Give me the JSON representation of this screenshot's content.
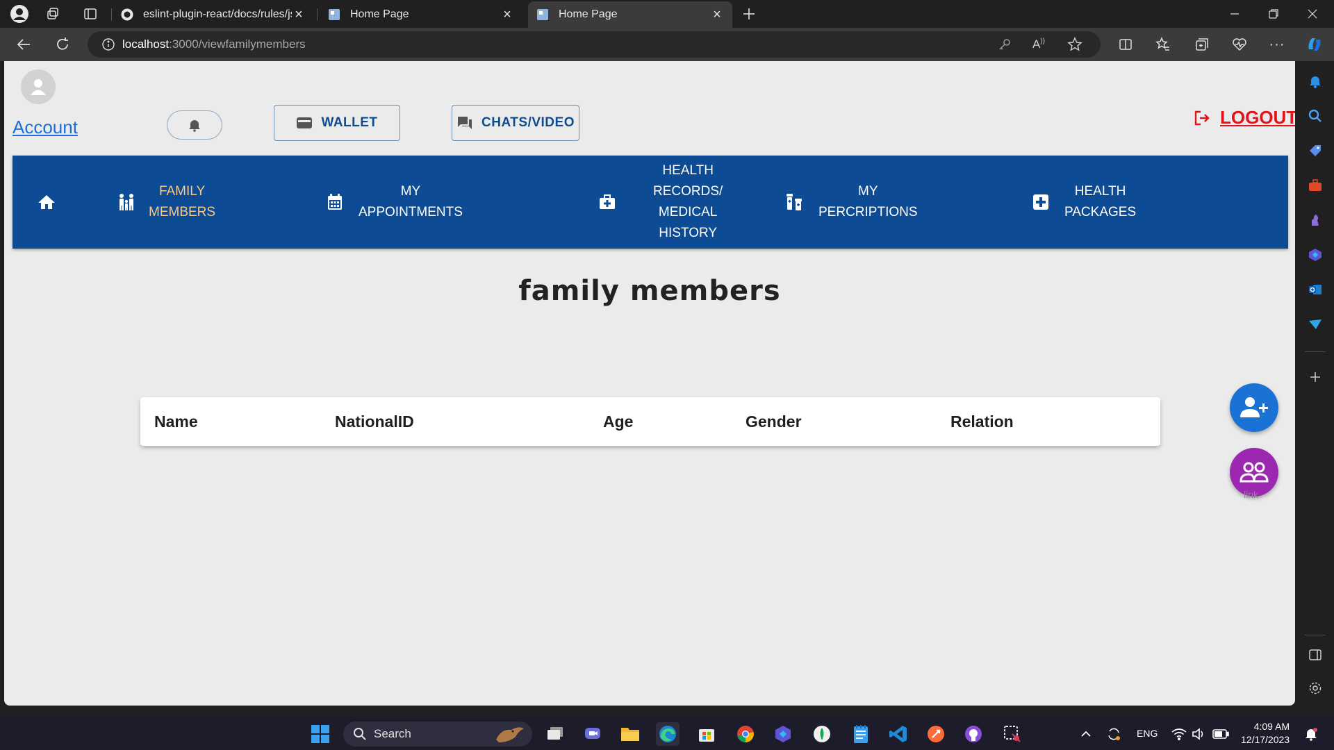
{
  "browser": {
    "tabs": [
      {
        "title": "eslint-plugin-react/docs/rules/jsx",
        "active": false
      },
      {
        "title": "Home Page",
        "active": false
      },
      {
        "title": "Home Page",
        "active": true
      }
    ],
    "address": {
      "host": "localhost",
      "path": ":3000/viewfamilymembers"
    }
  },
  "header": {
    "account_label": "Account",
    "wallet_label": "WALLET",
    "chats_label": "CHATS/VIDEO",
    "logout_label": "LOGOUT"
  },
  "nav": {
    "items": [
      {
        "line1": "FAMILY",
        "line2": "MEMBERS",
        "active": true
      },
      {
        "line1": "MY",
        "line2": "APPOINTMENTS"
      },
      {
        "line1": "HEALTH",
        "line2": "RECORDS/",
        "line3": "MEDICAL",
        "line4": "HISTORY"
      },
      {
        "line1": "MY",
        "line2": "PERCRIPTIONS"
      },
      {
        "line1": "HEALTH",
        "line2": "PACKAGES"
      }
    ]
  },
  "page": {
    "title": "family members",
    "table_headers": [
      "Name",
      "NationalID",
      "Age",
      "Gender",
      "Relation"
    ],
    "fab_link_label": "link"
  },
  "taskbar": {
    "search_placeholder": "Search",
    "language": "ENG",
    "time": "4:09 AM",
    "date": "12/17/2023"
  },
  "colors": {
    "nav_bg": "#0d4b94",
    "active_nav_text": "#f5c98a",
    "logout": "#e3131b",
    "fab_add": "#1a73d4",
    "fab_link": "#9c27b0"
  }
}
